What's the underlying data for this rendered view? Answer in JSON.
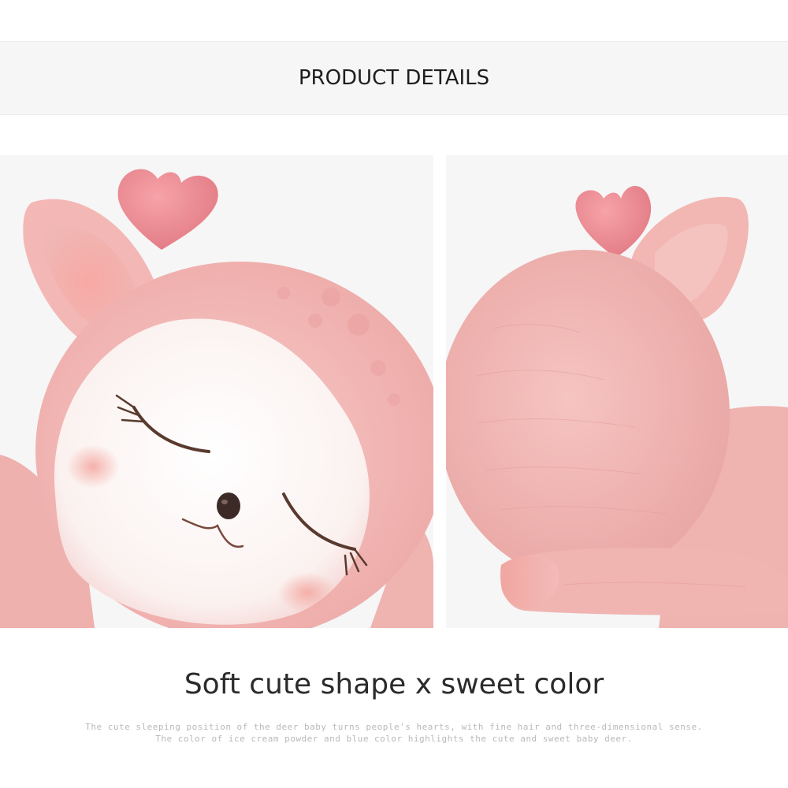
{
  "header": {
    "title": "PRODUCT DETAILS"
  },
  "photos": [
    {
      "subject": "sleeping-deer-face-closeup",
      "view": "front"
    },
    {
      "subject": "sleeping-deer-back-closeup",
      "view": "back"
    }
  ],
  "headline": "Soft cute shape x sweet color",
  "description": {
    "line1": "The cute sleeping position of the deer baby turns people's hearts, with fine hair and three-dimensional sense.",
    "line2": "The color of ice cream powder and blue color highlights the cute and sweet baby deer."
  },
  "colors": {
    "body_pink": "#f3b9b7",
    "antler_pink": "#ee8a91",
    "face_white": "#fbf6f4",
    "background": "#f6f6f6"
  }
}
